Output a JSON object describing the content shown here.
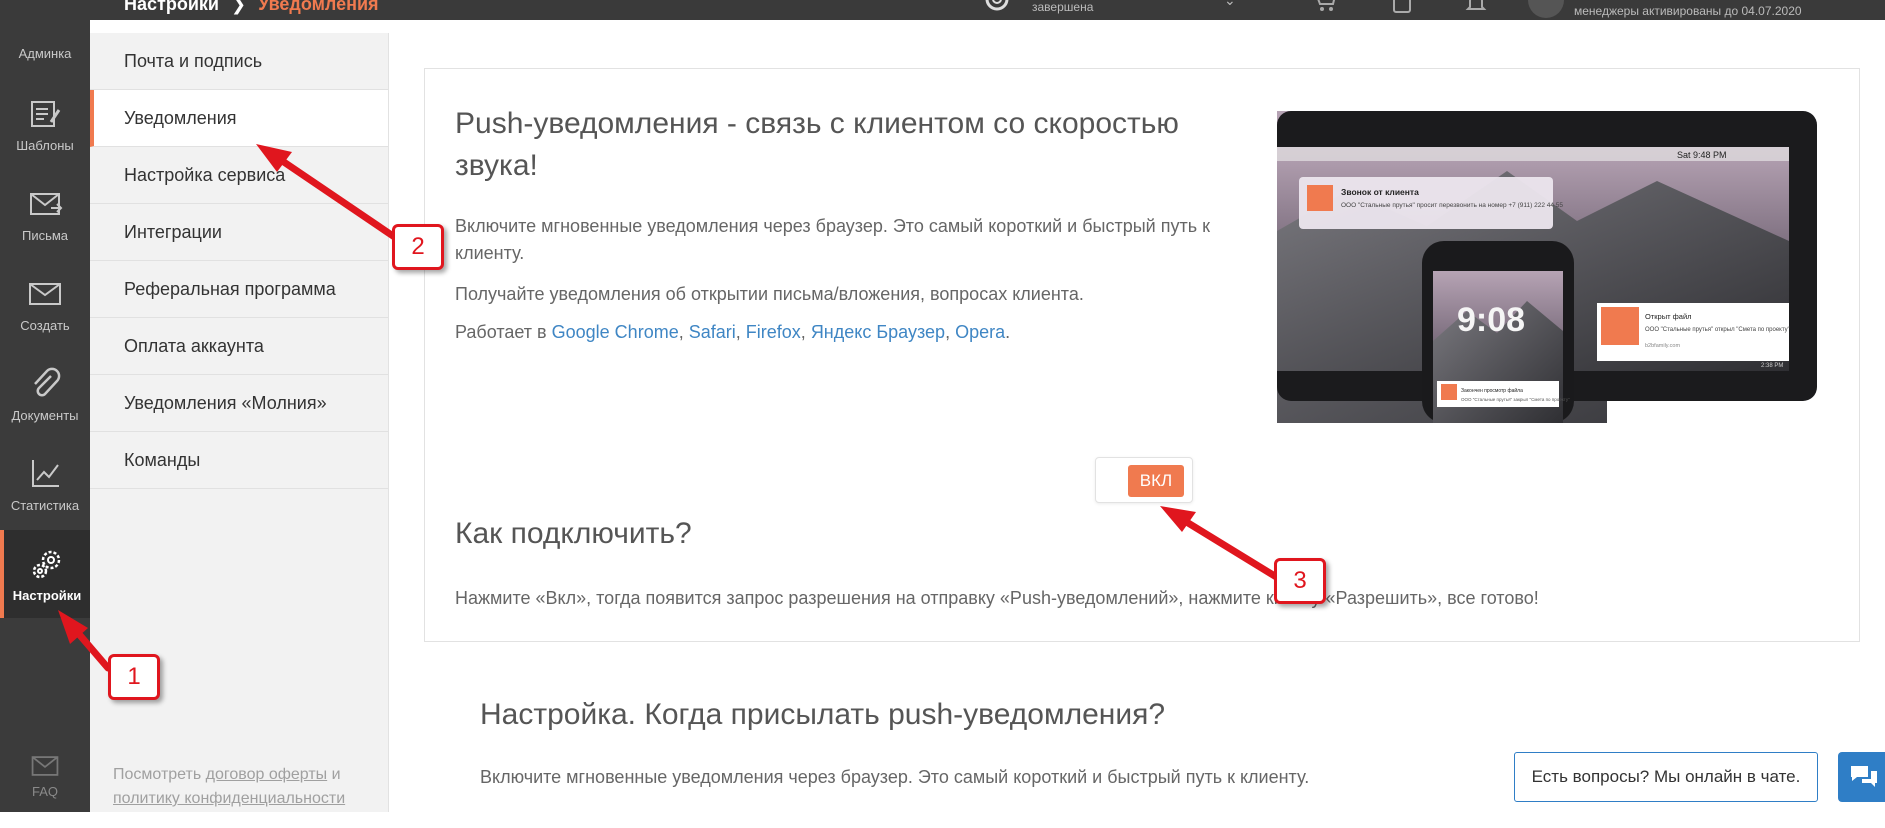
{
  "header": {
    "breadcrumb_root": "Настройки",
    "breadcrumb_current": "Уведомления",
    "status_text": "завершена",
    "account_text": "менеджеры активированы до 04.07.2020"
  },
  "rail": {
    "admin_label": "Админка",
    "items": [
      {
        "label": "Шаблоны",
        "icon": "template-icon"
      },
      {
        "label": "Письма",
        "icon": "letters-icon"
      },
      {
        "label": "Создать",
        "icon": "create-mail-icon"
      },
      {
        "label": "Документы",
        "icon": "paperclip-icon"
      },
      {
        "label": "Статистика",
        "icon": "stats-chart-icon"
      },
      {
        "label": "Настройки",
        "icon": "gears-icon"
      }
    ],
    "faq_label": "FAQ"
  },
  "submenu": {
    "items": [
      "Почта и подпись",
      "Уведомления",
      "Настройка сервиса",
      "Интеграции",
      "Реферальная программа",
      "Оплата аккаунта",
      "Уведомления «Молния»",
      "Команды"
    ],
    "active_index": 1,
    "footer_prefix": "Посмотреть",
    "footer_link1": "договор оферты",
    "footer_and": "и",
    "footer_link2": "политику конфиденциальности"
  },
  "card": {
    "title": "Push-уведомления - связь с клиентом со скоростью звука!",
    "p1": "Включите мгновенные уведомления через браузер. Это самый короткий и быстрый путь к клиенту.",
    "p2": "Получайте уведомления об открытии письма/вложения, вопросах клиента.",
    "p3_prefix": "Работает в",
    "browsers": [
      "Google Chrome",
      "Safari",
      "Firefox",
      "Яндекс Браузер",
      "Opera"
    ],
    "toggle_label": "ВКЛ",
    "toggle_state": "on",
    "how_title": "Как подключить?",
    "how_text": "Нажмите «Вкл», тогда появится запрос разрешения на отправку «Push-уведомлений», нажмите кнопку «Разрешить», все готово!",
    "promo": {
      "menubar_time": "Sat 9:48 PM",
      "notif1_title": "Звонок от клиента",
      "notif1_body": "ООО \"Стальные прутья\" просит перезвонить на номер +7 (911) 222 44 55",
      "phone_time": "9:08",
      "phone_notif_title": "Закончен просмотр файла",
      "phone_notif_body": "ООО \"Стальные прутья\" закрыл \"Смета по проекту\"",
      "notif2_title": "Открыт файл",
      "notif2_body": "ООО \"Стальные прутья\" открыл \"Смета по проекту\"",
      "notif2_site": "b2bfamily.com",
      "screen_time": "2:38 PM"
    }
  },
  "settings_section": {
    "title": "Настройка. Когда присылать push-уведомления?",
    "text": "Включите мгновенные уведомления через браузер. Это самый короткий и быстрый путь к клиенту."
  },
  "chat": {
    "bubble_text": "Есть вопросы? Мы онлайн в чате.",
    "icon": "chat-bubbles-icon"
  },
  "annotations": [
    "1",
    "2",
    "3"
  ],
  "colors": {
    "accent": "#f07a4f",
    "rail_bg": "#3b3b3b",
    "link": "#3f86c4",
    "annotation_red": "#e0161e",
    "chat_blue": "#2f7ec6"
  }
}
